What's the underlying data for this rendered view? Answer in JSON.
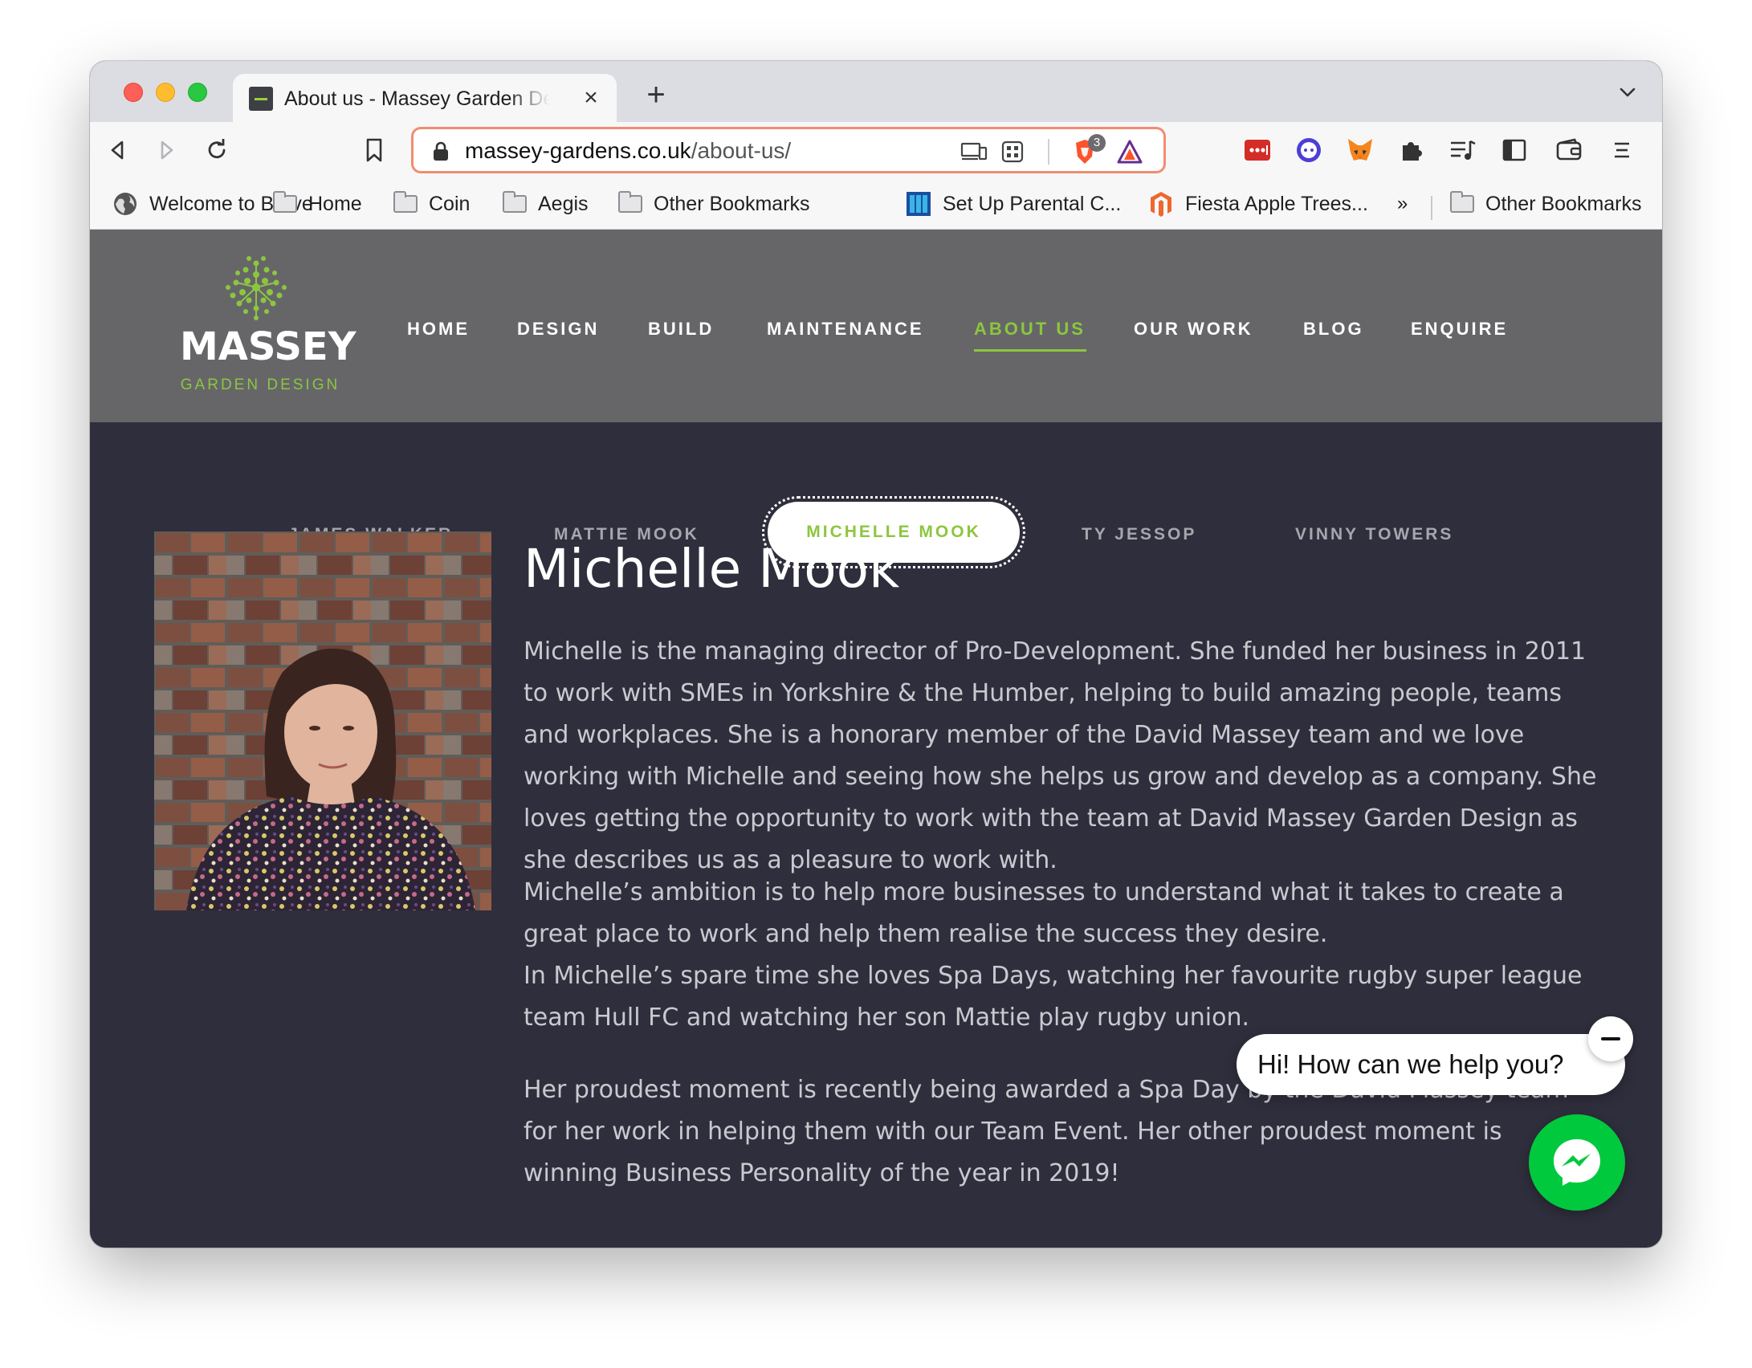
{
  "browser": {
    "tab_title": "About us - Massey Garden Design",
    "url_host": "massey-gardens.co.uk",
    "url_path": "/about-us/",
    "shields_count": "3",
    "bookmarks": [
      {
        "label": "Welcome to Brave"
      },
      {
        "label": "Home"
      },
      {
        "label": "Coin"
      },
      {
        "label": "Aegis"
      },
      {
        "label": "Other Bookmarks"
      },
      {
        "label": "Set Up Parental C..."
      },
      {
        "label": "Fiesta Apple Trees..."
      },
      {
        "label": "Other Bookmarks"
      }
    ],
    "bookmarks_overflow": "»"
  },
  "site": {
    "logo_name": "MASSEY",
    "logo_sub": "GARDEN DESIGN",
    "nav": [
      {
        "label": "HOME"
      },
      {
        "label": "DESIGN"
      },
      {
        "label": "BUILD"
      },
      {
        "label": "MAINTENANCE"
      },
      {
        "label": "ABOUT US",
        "active": true
      },
      {
        "label": "OUR WORK"
      },
      {
        "label": "BLOG"
      },
      {
        "label": "ENQUIRE"
      }
    ],
    "accent_color": "#8cc63f"
  },
  "team": {
    "tabs": [
      {
        "label": "JAMES WALKER"
      },
      {
        "label": "MATTIE MOOK"
      },
      {
        "label": "MICHELLE MOOK",
        "active": true
      },
      {
        "label": "TY JESSOP"
      },
      {
        "label": "VINNY TOWERS"
      }
    ]
  },
  "profile": {
    "name": "Michelle Mook",
    "para1": "Michelle is the managing director of Pro-Development. She funded her business in 2011 to work with SMEs in Yorkshire & the Humber, helping to build amazing people, teams and workplaces. She is a honorary member of the David Massey team and we love working with Michelle and seeing how she helps us grow and develop as a company. She loves getting the opportunity to work with the team at David Massey Garden Design as she describes us as a pleasure to work with.",
    "para2a": "Michelle’s ambition is to help more businesses to understand what it takes to create a great place to work and help them realise the success they desire.",
    "para2b": "In Michelle’s spare time she loves Spa Days, watching her favourite rugby super league team Hull FC and watching her son Mattie play rugby union.",
    "para3": "Her proudest moment is recently being awarded a Spa Day by the David Massey team for her work in helping them with our Team Event. Her other proudest moment is winning Business Personality of the year in 2019!"
  },
  "chat": {
    "greeting": "Hi! How can we help you?"
  }
}
